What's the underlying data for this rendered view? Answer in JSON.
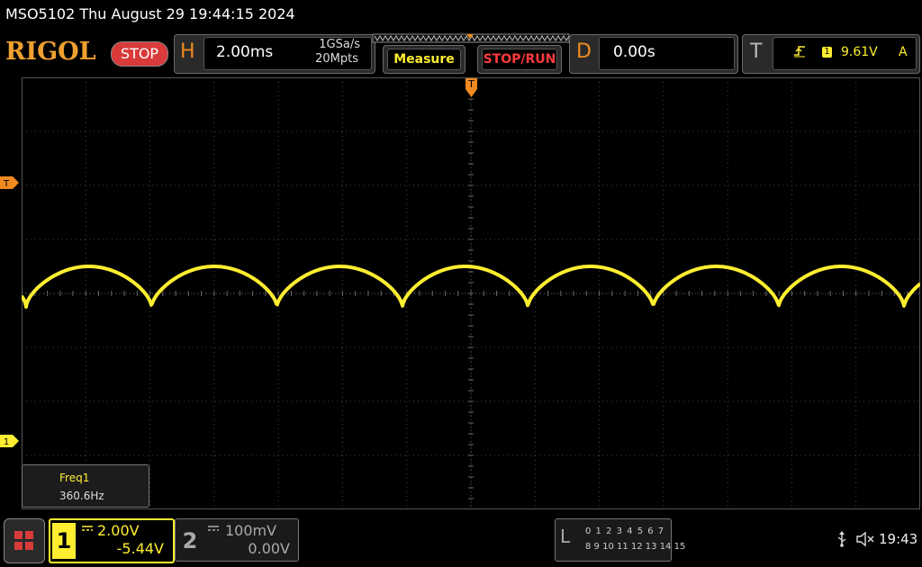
{
  "title_bar": {
    "text": "MSO5102  Thu August 29 19:44:15 2024"
  },
  "toolbar": {
    "logo": "RIGOL",
    "run_state": "STOP",
    "horizontal": {
      "letter": "H",
      "timebase": "2.00ms",
      "sample_rate": "1GSa/s",
      "memory_depth": "20Mpts"
    },
    "measure_label": "Measure",
    "stop_run_label": "STOP/RUN",
    "delay": {
      "letter": "D",
      "value": "0.00s"
    },
    "trigger": {
      "letter": "T",
      "edge_icon": "rising-edge-icon",
      "source": "1",
      "level": "9.61V",
      "mode": "A"
    }
  },
  "markers": {
    "trigger_position": "T",
    "trigger_level": "T",
    "ch1_ground": "1"
  },
  "measurement": {
    "label": "Freq1",
    "value": "360.6Hz"
  },
  "channels": [
    {
      "number": "1",
      "coupling_icon": "dc-coupling-icon",
      "scale": "2.00V",
      "offset": "-5.44V",
      "color": "#ffee30",
      "active": true
    },
    {
      "number": "2",
      "coupling_icon": "dc-coupling-icon",
      "scale": "100mV",
      "offset": "0.00V",
      "color": "#aaaaaa",
      "active": false
    }
  ],
  "logic": {
    "letter": "L",
    "row1": "0 1 2 3   4 5 6 7",
    "row2": "8  9 10 11  12 13 14 15"
  },
  "status": {
    "usb_icon": "usb-icon",
    "speaker_icon": "speaker-muted-icon",
    "time": "19:43"
  },
  "colors": {
    "trace": "#ffee30",
    "accent_orange": "#f08a20",
    "stop_red": "#d93a3a"
  }
}
